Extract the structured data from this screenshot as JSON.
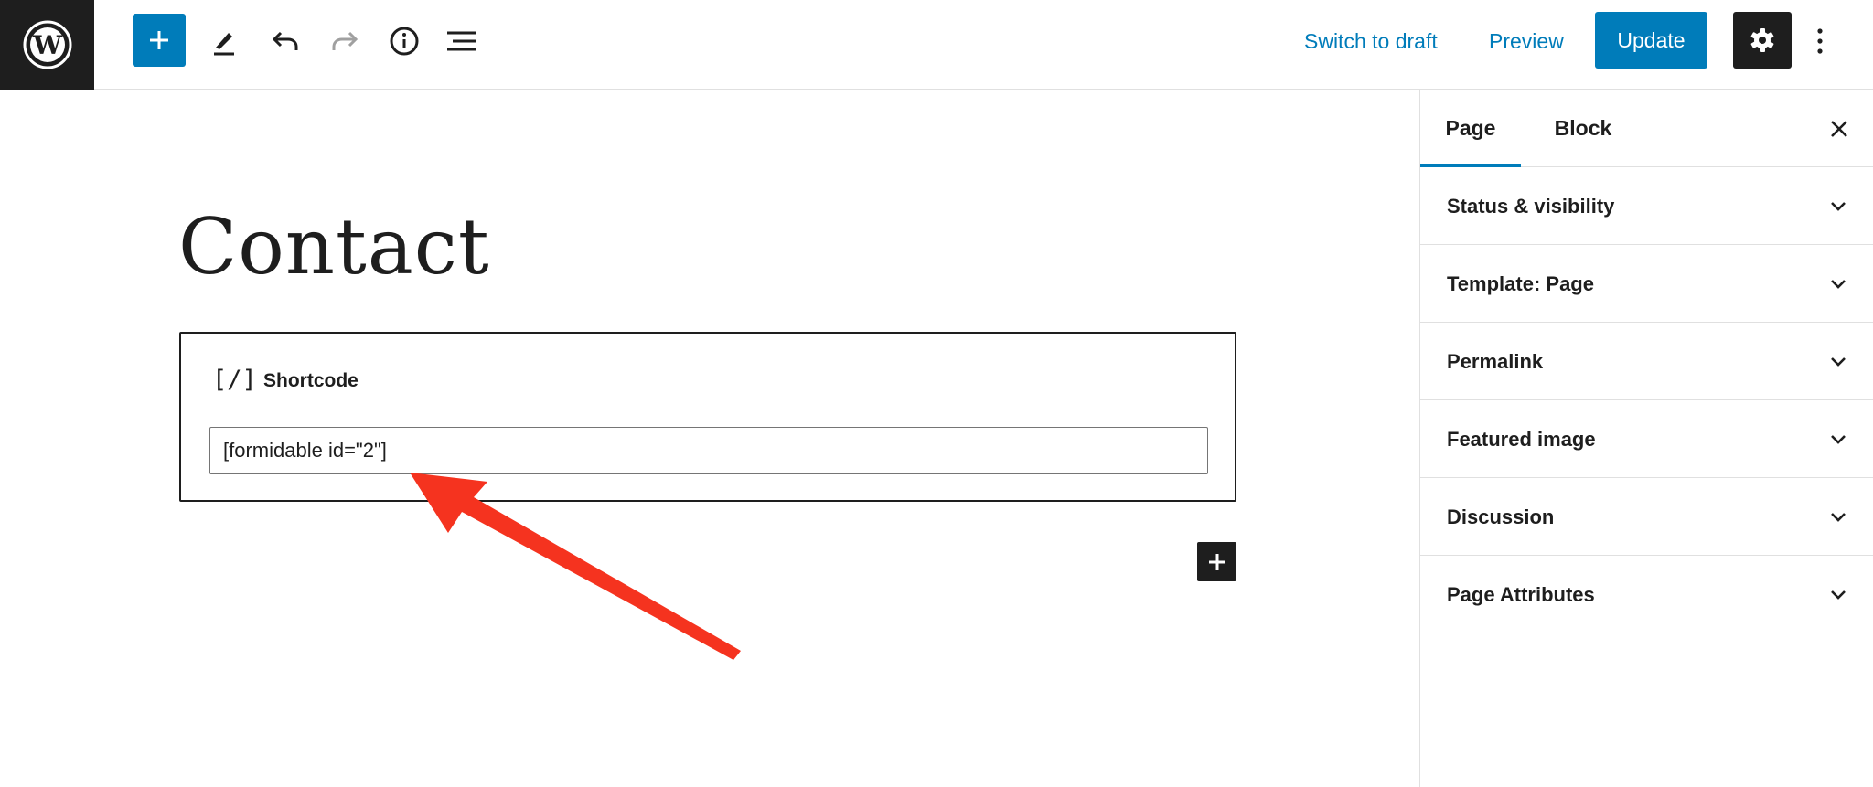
{
  "toolbar": {
    "add_block_icon": "plus-icon",
    "tools_icon": "pencil-icon",
    "undo_icon": "undo-icon",
    "redo_icon": "redo-icon",
    "details_icon": "info-icon",
    "outline_icon": "list-view-icon",
    "switch_to_draft": "Switch to draft",
    "preview": "Preview",
    "update": "Update",
    "settings_icon": "gear-icon",
    "more_icon": "more-vertical-icon"
  },
  "sidebar": {
    "tabs": [
      {
        "label": "Page",
        "active": true
      },
      {
        "label": "Block",
        "active": false
      }
    ],
    "panels": [
      {
        "label": "Status & visibility"
      },
      {
        "label": "Template: Page"
      },
      {
        "label": "Permalink"
      },
      {
        "label": "Featured image"
      },
      {
        "label": "Discussion"
      },
      {
        "label": "Page Attributes"
      }
    ]
  },
  "editor": {
    "title": "Contact",
    "block": {
      "icon_glyph": "[/]",
      "label": "Shortcode",
      "value": "[formidable id=\"2\"]"
    }
  },
  "colors": {
    "accent": "#007cba",
    "dark": "#1e1e1e",
    "annotation_arrow": "#f5331f"
  }
}
